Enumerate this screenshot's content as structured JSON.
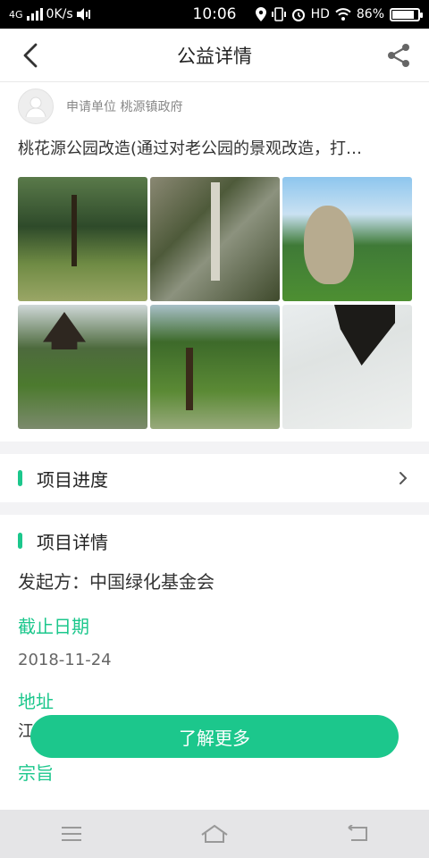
{
  "status_bar": {
    "network": "4G",
    "speed": "0K/s",
    "time": "10:06",
    "hd": "HD",
    "battery": "86%",
    "battery_level": 0.86
  },
  "header": {
    "title": "公益详情"
  },
  "applicant": {
    "label": "申请单位 桃源镇政府"
  },
  "project": {
    "description": "桃花源公园改造(通过对老公园的景观改造，打…",
    "photos": [
      "park-lawn",
      "overgrown-pergola",
      "large-rock",
      "pavilion",
      "tree-lawn",
      "damaged-ceiling"
    ]
  },
  "progress": {
    "title": "项目进度"
  },
  "details": {
    "title": "项目详情",
    "initiator": "发起方：中国绿化基金会",
    "deadline_label": "截止日期",
    "deadline_value": "2018-11-24",
    "address_label": "地址",
    "address_value": "江",
    "purpose_label": "宗旨"
  },
  "cta": {
    "label": "了解更多"
  },
  "colors": {
    "accent": "#1cc78c"
  }
}
